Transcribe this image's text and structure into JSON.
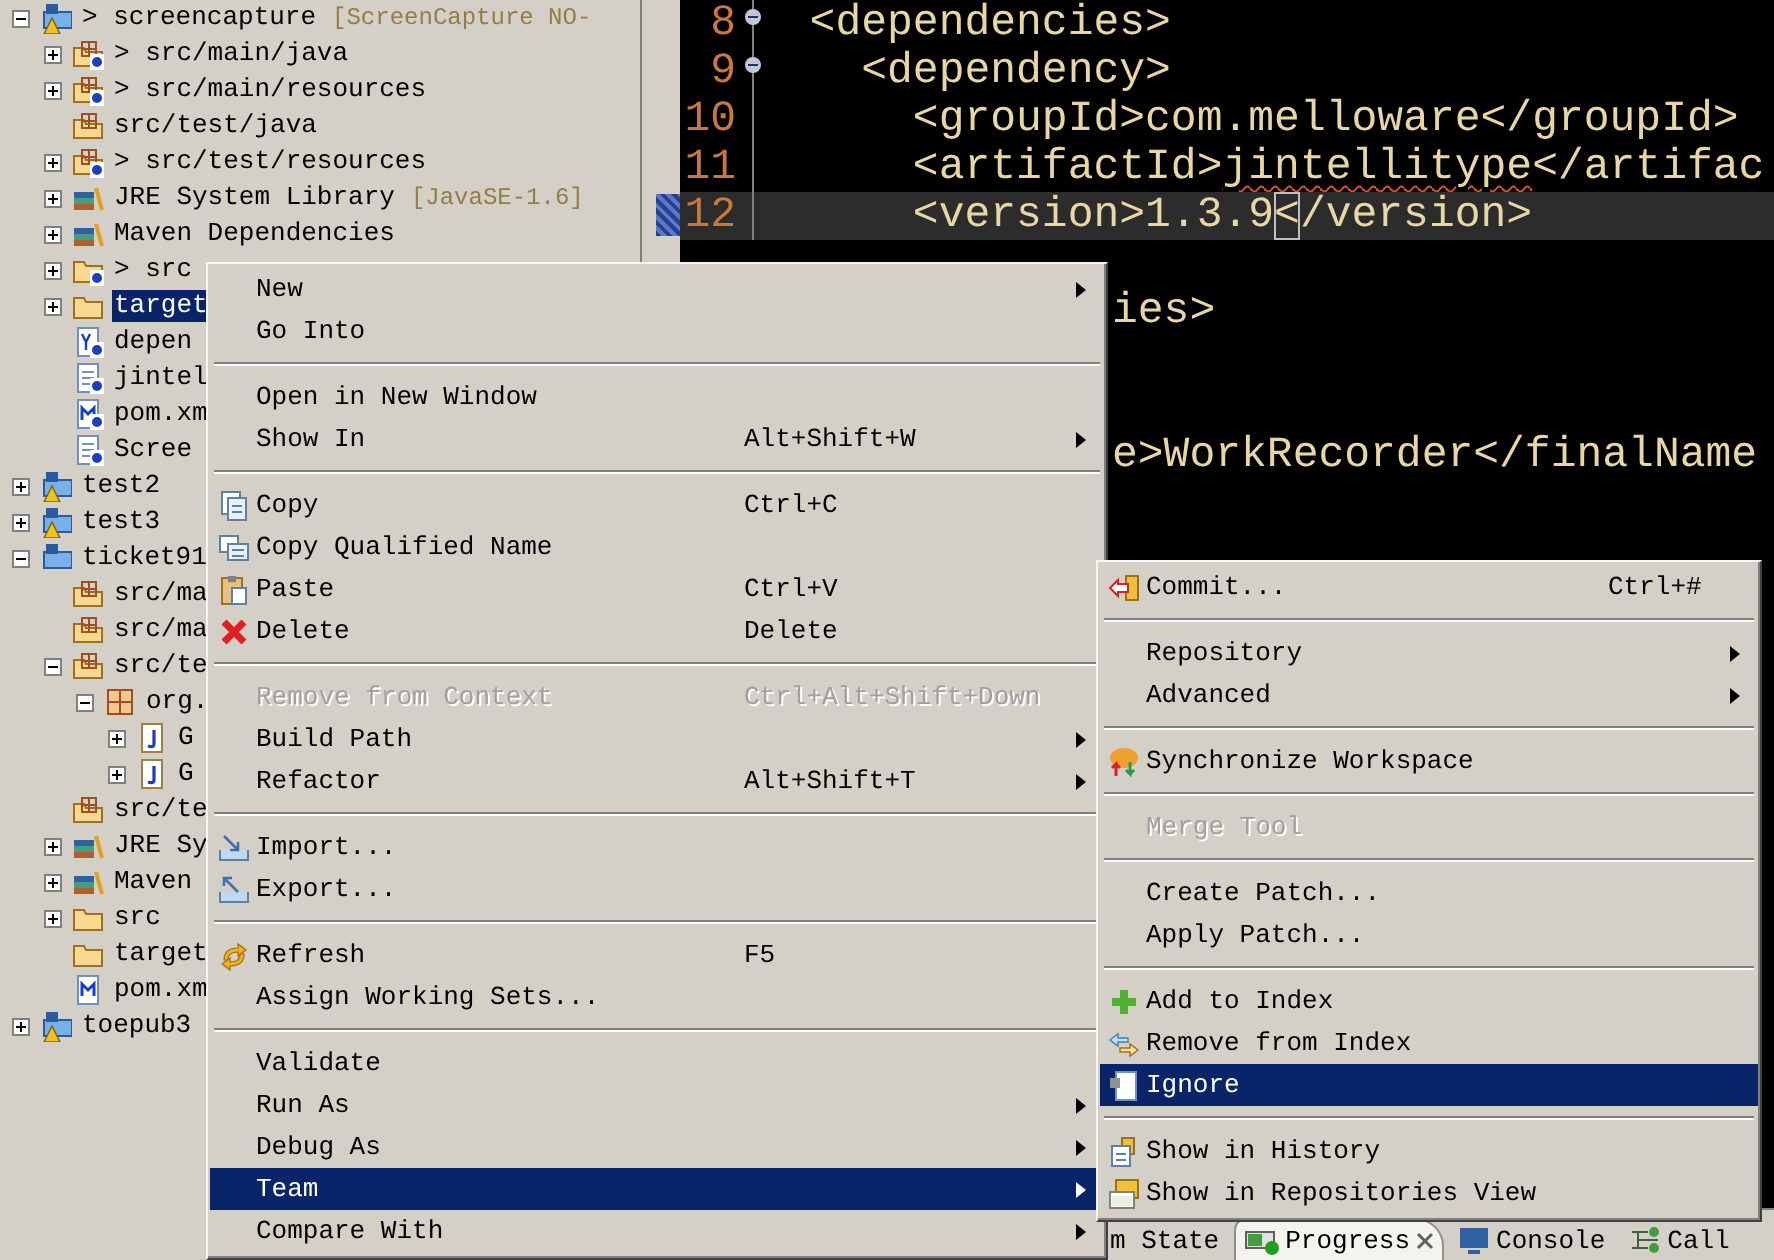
{
  "tree": [
    {
      "label": "> screencapture",
      "decoration": "[ScreenCapture NO-",
      "kind": "project",
      "warning": true,
      "untracked": false,
      "selected": false,
      "expanded": true,
      "children": [
        {
          "label": "> src/main/java",
          "kind": "source-folder",
          "untracked": true,
          "selected": false,
          "expanded": false
        },
        {
          "label": "> src/main/resources",
          "kind": "source-folder",
          "untracked": true,
          "selected": false,
          "expanded": false
        },
        {
          "label": "src/test/java",
          "kind": "source-folder",
          "untracked": false,
          "selected": false
        },
        {
          "label": "> src/test/resources",
          "kind": "source-folder",
          "untracked": true,
          "selected": false,
          "expanded": false
        },
        {
          "label": "JRE System Library",
          "decoration": "[JavaSE-1.6]",
          "kind": "library",
          "untracked": false,
          "selected": false,
          "expanded": false
        },
        {
          "label": "Maven Dependencies",
          "kind": "library",
          "untracked": false,
          "selected": false,
          "expanded": false
        },
        {
          "label": "> src",
          "kind": "folder",
          "untracked": true,
          "selected": false,
          "expanded": false
        },
        {
          "label": "target",
          "kind": "folder",
          "untracked": false,
          "selected": true,
          "expanded": false
        },
        {
          "label": "depen",
          "kind": "yaml-file",
          "untracked": true,
          "selected": false
        },
        {
          "label": "jintel",
          "kind": "file",
          "untracked": true,
          "selected": false
        },
        {
          "label": "pom.xm",
          "kind": "pom",
          "untracked": true,
          "selected": false
        },
        {
          "label": "Scree",
          "kind": "file",
          "untracked": true,
          "selected": false
        }
      ]
    },
    {
      "label": "test2",
      "kind": "project",
      "warning": true,
      "untracked": false,
      "selected": false,
      "expanded": false
    },
    {
      "label": "test3",
      "kind": "project",
      "warning": true,
      "untracked": false,
      "selected": false,
      "expanded": false
    },
    {
      "label": "ticket91",
      "kind": "project",
      "warning": false,
      "untracked": false,
      "selected": false,
      "expanded": true,
      "children": [
        {
          "label": "src/ma",
          "kind": "source-folder",
          "untracked": false,
          "selected": false
        },
        {
          "label": "src/ma",
          "kind": "source-folder",
          "untracked": false,
          "selected": false
        },
        {
          "label": "src/te",
          "kind": "source-folder",
          "untracked": false,
          "selected": false,
          "expanded": true,
          "children": [
            {
              "label": "org.",
              "kind": "package",
              "untracked": false,
              "selected": false,
              "expanded": true,
              "children": [
                {
                  "label": "G",
                  "kind": "class",
                  "untracked": false,
                  "selected": false,
                  "expanded": false
                },
                {
                  "label": "G",
                  "kind": "class",
                  "untracked": false,
                  "selected": false,
                  "expanded": false
                }
              ]
            }
          ]
        },
        {
          "label": "src/te",
          "kind": "source-folder",
          "untracked": false,
          "selected": false
        },
        {
          "label": "JRE Sy",
          "kind": "library",
          "untracked": false,
          "selected": false,
          "expanded": false
        },
        {
          "label": "Maven",
          "kind": "library",
          "untracked": false,
          "selected": false,
          "expanded": false
        },
        {
          "label": "src",
          "kind": "folder",
          "untracked": false,
          "selected": false,
          "expanded": false
        },
        {
          "label": "target",
          "kind": "folder",
          "untracked": false,
          "selected": false
        },
        {
          "label": "pom.xm",
          "kind": "pom",
          "untracked": false,
          "selected": false
        }
      ]
    },
    {
      "label": "toepub3",
      "kind": "project",
      "warning": true,
      "untracked": false,
      "selected": false,
      "expanded": false
    }
  ],
  "editor": {
    "lines": [
      {
        "kind": "line",
        "number": "8",
        "foldable": true,
        "current": false,
        "segments": [
          {
            "text": "  <dependencies>"
          }
        ]
      },
      {
        "kind": "line",
        "number": "9",
        "foldable": true,
        "current": false,
        "segments": [
          {
            "text": "    <dependency>"
          }
        ]
      },
      {
        "kind": "line",
        "number": "10",
        "foldable": false,
        "current": false,
        "segments": [
          {
            "text": "      <groupId>com.melloware</groupId>"
          }
        ]
      },
      {
        "kind": "line",
        "number": "11",
        "foldable": false,
        "current": false,
        "segments": [
          {
            "text": "      <artifactId>"
          },
          {
            "text": "jintellitype",
            "misspelled": true
          },
          {
            "text": "</artifac"
          }
        ]
      },
      {
        "kind": "line",
        "number": "12",
        "foldable": false,
        "current": true,
        "segments": [
          {
            "text": "      <version>1.3.9"
          },
          {
            "text": "<",
            "cursor": true
          },
          {
            "text": "/version>"
          }
        ]
      },
      {
        "kind": "blank"
      },
      {
        "kind": "fragment",
        "segments": [
          {
            "text": "ies>"
          }
        ]
      },
      {
        "kind": "blank"
      },
      {
        "kind": "blank"
      },
      {
        "kind": "fragment",
        "segments": [
          {
            "text": "e>WorkRecorder</finalName"
          }
        ]
      }
    ]
  },
  "bottom_tabs": [
    {
      "label": "m State",
      "selected": false
    },
    {
      "label": "Progress",
      "selected": true,
      "closable": true
    },
    {
      "label": "Console",
      "selected": false
    },
    {
      "label": "Call",
      "selected": false
    }
  ],
  "context_menu": [
    {
      "kind": "item",
      "label": "New",
      "submenu": true,
      "disabled": false,
      "selected": false
    },
    {
      "kind": "item",
      "label": "Go Into",
      "submenu": false,
      "disabled": false,
      "selected": false
    },
    {
      "kind": "separator"
    },
    {
      "kind": "item",
      "label": "Open in New Window",
      "submenu": false,
      "disabled": false,
      "selected": false
    },
    {
      "kind": "item",
      "label": "Show In",
      "shortcut": "Alt+Shift+W",
      "submenu": true,
      "disabled": false,
      "selected": false
    },
    {
      "kind": "separator"
    },
    {
      "kind": "item",
      "label": "Copy",
      "shortcut": "Ctrl+C",
      "submenu": false,
      "disabled": false,
      "selected": false
    },
    {
      "kind": "item",
      "label": "Copy Qualified Name",
      "submenu": false,
      "disabled": false,
      "selected": false
    },
    {
      "kind": "item",
      "label": "Paste",
      "shortcut": "Ctrl+V",
      "submenu": false,
      "disabled": false,
      "selected": false
    },
    {
      "kind": "item",
      "label": "Delete",
      "shortcut": "Delete",
      "submenu": false,
      "disabled": false,
      "selected": false
    },
    {
      "kind": "separator"
    },
    {
      "kind": "item",
      "label": "Remove from Context",
      "shortcut": "Ctrl+Alt+Shift+Down",
      "submenu": false,
      "disabled": true,
      "selected": false
    },
    {
      "kind": "item",
      "label": "Build Path",
      "submenu": true,
      "disabled": false,
      "selected": false
    },
    {
      "kind": "item",
      "label": "Refactor",
      "shortcut": "Alt+Shift+T",
      "submenu": true,
      "disabled": false,
      "selected": false
    },
    {
      "kind": "separator"
    },
    {
      "kind": "item",
      "label": "Import...",
      "submenu": false,
      "disabled": false,
      "selected": false
    },
    {
      "kind": "item",
      "label": "Export...",
      "submenu": false,
      "disabled": false,
      "selected": false
    },
    {
      "kind": "separator"
    },
    {
      "kind": "item",
      "label": "Refresh",
      "shortcut": "F5",
      "submenu": false,
      "disabled": false,
      "selected": false
    },
    {
      "kind": "item",
      "label": "Assign Working Sets...",
      "submenu": false,
      "disabled": false,
      "selected": false
    },
    {
      "kind": "separator"
    },
    {
      "kind": "item",
      "label": "Validate",
      "submenu": false,
      "disabled": false,
      "selected": false
    },
    {
      "kind": "item",
      "label": "Run As",
      "submenu": true,
      "disabled": false,
      "selected": false
    },
    {
      "kind": "item",
      "label": "Debug As",
      "submenu": true,
      "disabled": false,
      "selected": false
    },
    {
      "kind": "item",
      "label": "Team",
      "submenu": true,
      "disabled": false,
      "selected": true
    },
    {
      "kind": "item",
      "label": "Compare With",
      "submenu": true,
      "disabled": false,
      "selected": false
    }
  ],
  "team_submenu": [
    {
      "kind": "item",
      "label": "Commit...",
      "shortcut": "Ctrl+#",
      "submenu": false,
      "disabled": false,
      "selected": false
    },
    {
      "kind": "separator"
    },
    {
      "kind": "item",
      "label": "Repository",
      "submenu": true,
      "disabled": false,
      "selected": false
    },
    {
      "kind": "item",
      "label": "Advanced",
      "submenu": true,
      "disabled": false,
      "selected": false
    },
    {
      "kind": "separator"
    },
    {
      "kind": "item",
      "label": "Synchronize Workspace",
      "submenu": false,
      "disabled": false,
      "selected": false
    },
    {
      "kind": "separator"
    },
    {
      "kind": "item",
      "label": "Merge Tool",
      "submenu": false,
      "disabled": true,
      "selected": false
    },
    {
      "kind": "separator"
    },
    {
      "kind": "item",
      "label": "Create Patch...",
      "submenu": false,
      "disabled": false,
      "selected": false
    },
    {
      "kind": "item",
      "label": "Apply Patch...",
      "submenu": false,
      "disabled": false,
      "selected": false
    },
    {
      "kind": "separator"
    },
    {
      "kind": "item",
      "label": "Add to Index",
      "submenu": false,
      "disabled": false,
      "selected": false
    },
    {
      "kind": "item",
      "label": "Remove from Index",
      "submenu": false,
      "disabled": false,
      "selected": false
    },
    {
      "kind": "item",
      "label": "Ignore",
      "submenu": false,
      "disabled": false,
      "selected": true
    },
    {
      "kind": "separator"
    },
    {
      "kind": "item",
      "label": "Show in History",
      "submenu": false,
      "disabled": false,
      "selected": false
    },
    {
      "kind": "item",
      "label": "Show in Repositories View",
      "submenu": false,
      "disabled": false,
      "selected": false
    }
  ]
}
